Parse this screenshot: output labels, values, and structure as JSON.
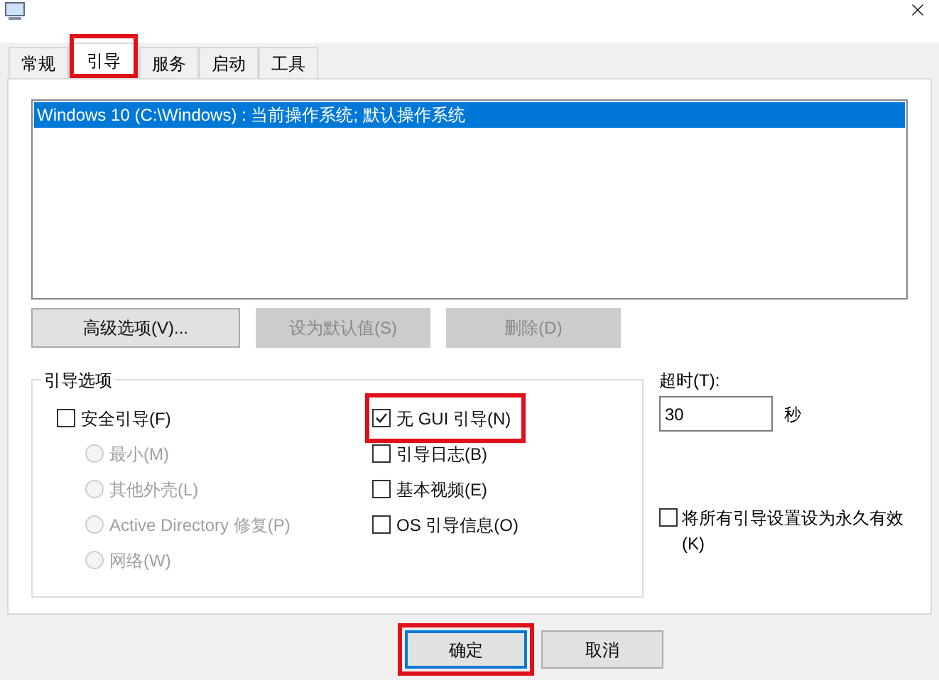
{
  "tabs": [
    {
      "label": "常规",
      "selected": false,
      "highlighted": false
    },
    {
      "label": "引导",
      "selected": true,
      "highlighted": true
    },
    {
      "label": "服务",
      "selected": false,
      "highlighted": false
    },
    {
      "label": "启动",
      "selected": false,
      "highlighted": false
    },
    {
      "label": "工具",
      "selected": false,
      "highlighted": false
    }
  ],
  "boot_list": [
    {
      "label": "Windows 10 (C:\\Windows) : 当前操作系统; 默认操作系统",
      "selected": true
    }
  ],
  "list_buttons": [
    {
      "label": "高级选项(V)...",
      "disabled": false
    },
    {
      "label": "设为默认值(S)",
      "disabled": true
    },
    {
      "label": "删除(D)",
      "disabled": true
    }
  ],
  "boot_options": {
    "title": "引导选项",
    "left": [
      {
        "kind": "checkbox",
        "label": "安全引导(F)",
        "checked": false,
        "disabled": false
      },
      {
        "kind": "radio",
        "label": "最小(M)",
        "selected": false,
        "disabled": true
      },
      {
        "kind": "radio",
        "label": "其他外壳(L)",
        "selected": false,
        "disabled": true
      },
      {
        "kind": "radio",
        "label": "Active Directory 修复(P)",
        "selected": false,
        "disabled": true
      },
      {
        "kind": "radio",
        "label": "网络(W)",
        "selected": false,
        "disabled": true
      }
    ],
    "right": [
      {
        "kind": "checkbox",
        "label": "无 GUI 引导(N)",
        "checked": true,
        "highlighted": true
      },
      {
        "kind": "checkbox",
        "label": "引导日志(B)",
        "checked": false,
        "highlighted": false
      },
      {
        "kind": "checkbox",
        "label": "基本视频(E)",
        "checked": false,
        "highlighted": false
      },
      {
        "kind": "checkbox",
        "label": "OS 引导信息(O)",
        "checked": false,
        "highlighted": false
      }
    ]
  },
  "timeout": {
    "label": "超时(T):",
    "value": "30",
    "unit": "秒"
  },
  "make_permanent": {
    "label": "将所有引导设置设为永久有效(K)",
    "checked": false
  },
  "dialog_buttons": [
    {
      "label": "确定",
      "default": true,
      "highlighted": true
    },
    {
      "label": "取消",
      "default": false,
      "highlighted": false
    }
  ]
}
